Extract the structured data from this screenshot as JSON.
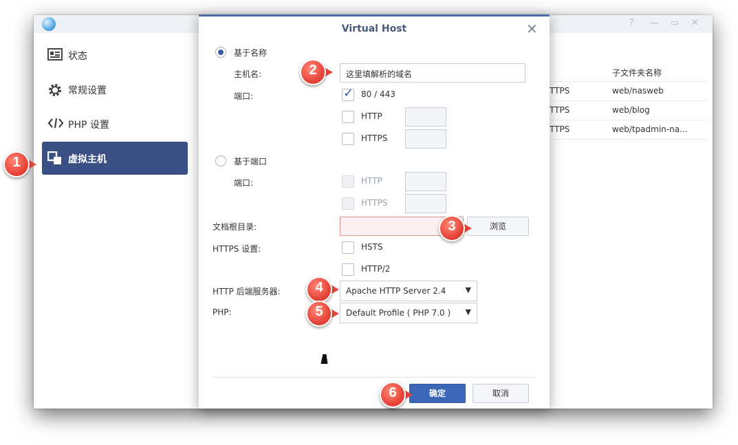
{
  "sidebar": {
    "items": [
      {
        "label": "状态",
        "icon": "status-card-icon"
      },
      {
        "label": "常规设置",
        "icon": "gear-icon"
      },
      {
        "label": "PHP 设置",
        "icon": "code-icon"
      },
      {
        "label": "虚拟主机",
        "icon": "virtual-host-icon",
        "active": true
      }
    ]
  },
  "background_table": {
    "header": "子文件夹名称",
    "rows": [
      {
        "protocol": "TTPS",
        "folder": "web/nasweb"
      },
      {
        "protocol": "TTPS",
        "folder": "web/blog"
      },
      {
        "protocol": "TTPS",
        "folder": "web/tpadmin-na..."
      }
    ]
  },
  "dialog": {
    "title": "Virtual Host",
    "name_based": {
      "label": "基于名称",
      "selected": true,
      "hostname_label": "主机名:",
      "hostname_value": "这里填解析的域名",
      "port_label": "端口:",
      "ports": [
        {
          "label": "80 / 443",
          "checked": true
        },
        {
          "label": "HTTP",
          "checked": false
        },
        {
          "label": "HTTPS",
          "checked": false
        }
      ]
    },
    "port_based": {
      "label": "基于端口",
      "selected": false,
      "port_label": "端口:",
      "ports": [
        {
          "label": "HTTP",
          "disabled": true
        },
        {
          "label": "HTTPS",
          "disabled": true
        }
      ]
    },
    "docroot_label": "文档根目录:",
    "browse_label": "浏览",
    "https_settings_label": "HTTPS 设置:",
    "hsts_label": "HSTS",
    "http2_label": "HTTP/2",
    "backend_label": "HTTP 后端服务器:",
    "backend_value": "Apache HTTP Server 2.4",
    "php_label": "PHP:",
    "php_value": "Default Profile ( PHP 7.0 )",
    "ok_label": "确定",
    "cancel_label": "取消"
  },
  "callouts": [
    "1",
    "2",
    "3",
    "4",
    "5",
    "6"
  ],
  "colors": {
    "accent": "#3c67b7",
    "sidebar_active": "#3a4f84",
    "callout": "#e8463a"
  }
}
